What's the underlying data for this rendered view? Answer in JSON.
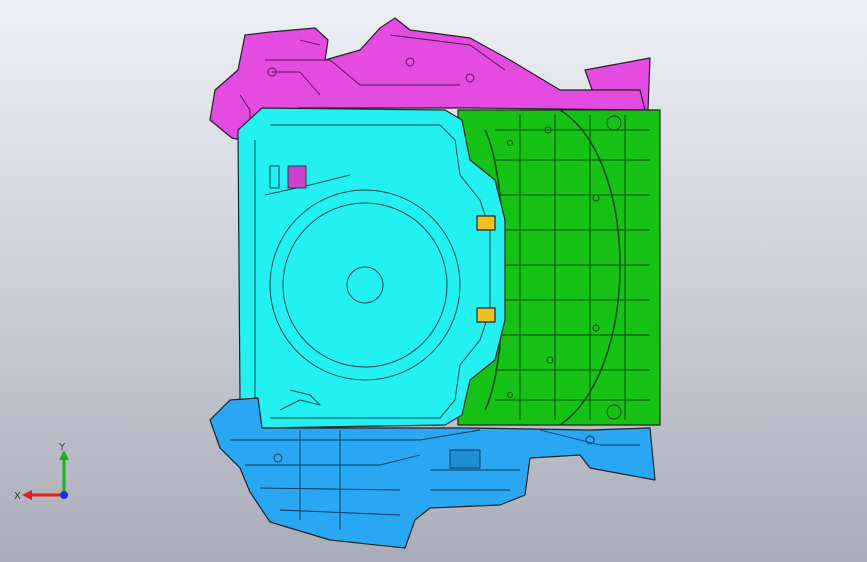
{
  "viewport": {
    "background_top": "#eef0f5",
    "background_bottom": "#a9adb9"
  },
  "parts": [
    {
      "id": "magenta-top-bracket",
      "color": "#e44be0"
    },
    {
      "id": "cyan-tray-panel",
      "color": "#23f0f0"
    },
    {
      "id": "green-rear-panel",
      "color": "#17c217"
    },
    {
      "id": "blue-bottom-duct",
      "color": "#2aa7f2"
    },
    {
      "id": "magenta-right-flap",
      "color": "#e44be0"
    }
  ],
  "triad": {
    "x_label": "X",
    "y_label": "Y",
    "x_color": "#e02020",
    "y_color": "#20b020",
    "z_color": "#2030e0"
  }
}
